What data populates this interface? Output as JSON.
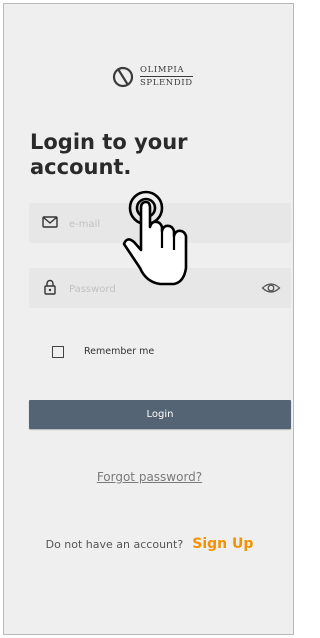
{
  "brand": {
    "line1": "OLIMPIA",
    "line2": "SPLENDID"
  },
  "heading": "Login to your account.",
  "email": {
    "placeholder": "e-mail",
    "value": ""
  },
  "password": {
    "placeholder": "Password",
    "value": ""
  },
  "remember": {
    "label": "Remember me",
    "checked": false
  },
  "login": {
    "label": "Login"
  },
  "forgot": {
    "label": "Forgot password?"
  },
  "signup": {
    "question": "Do not have an account?",
    "link": "Sign Up"
  },
  "icons": {
    "email": "envelope-icon",
    "password": "lock-icon",
    "visibility": "eye-icon",
    "gesture": "tap-hand-icon"
  },
  "colors": {
    "background": "#efefef",
    "field": "#e7e7e7",
    "button": "#556474",
    "accent": "#f39200"
  }
}
